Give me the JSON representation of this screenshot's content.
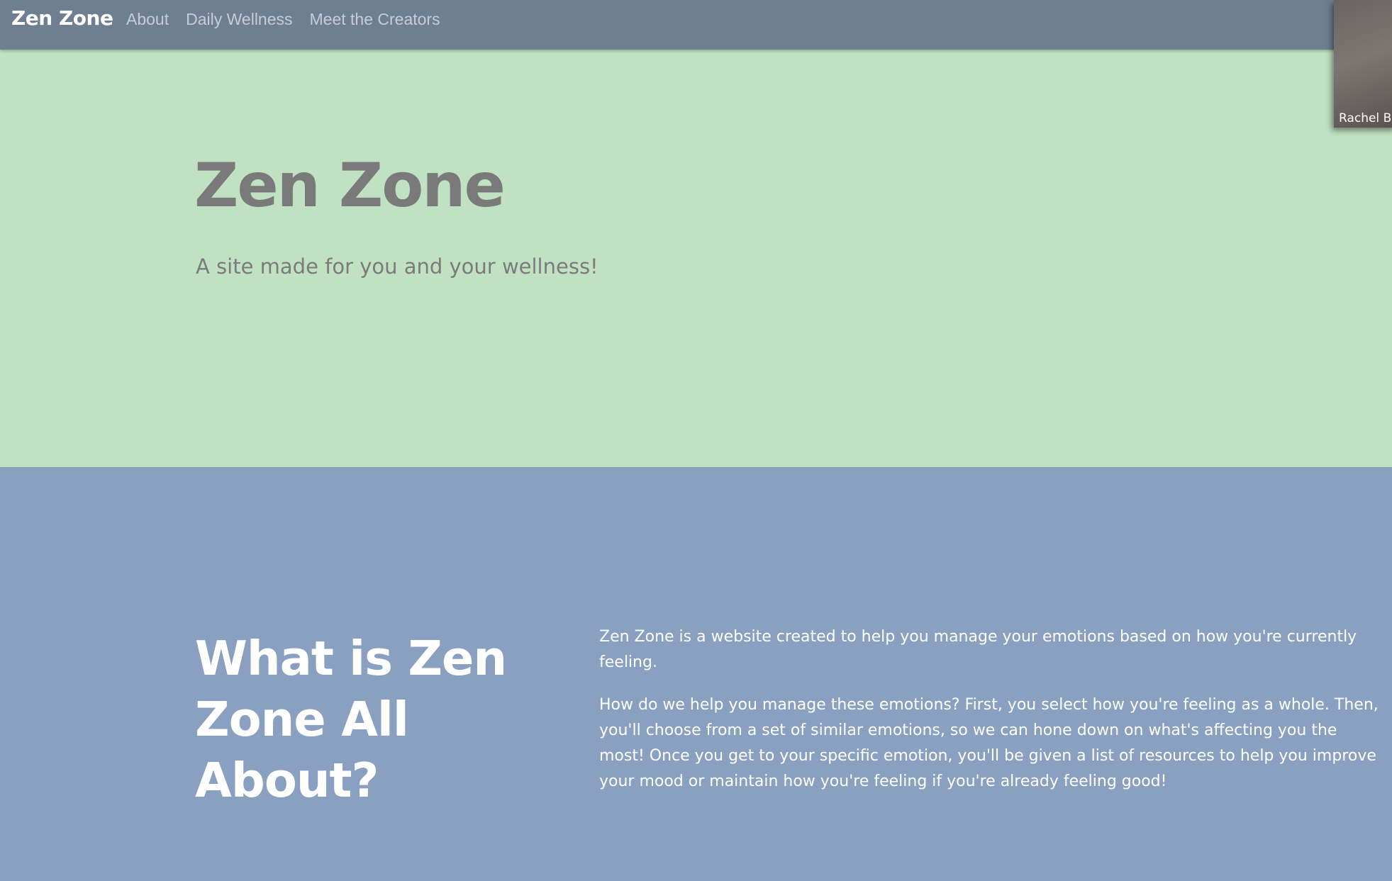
{
  "nav": {
    "brand": "Zen Zone",
    "links": [
      {
        "label": "About"
      },
      {
        "label": "Daily Wellness"
      },
      {
        "label": "Meet the Creators"
      }
    ]
  },
  "hero": {
    "title": "Zen Zone",
    "subtitle": "A site made for you and your wellness!"
  },
  "about": {
    "heading": "What is Zen Zone All About?",
    "paragraphs": [
      "Zen Zone is a website created to help you manage your emotions based on how you're currently feeling.",
      "How do we help you manage these emotions? First, you select how you're feeling as a whole. Then, you'll choose from a set of similar emotions, so we can hone down on what's affecting you the most! Once you get to your specific emotion, you'll be given a list of resources to help you improve your mood or maintain how you're feeling if you're already feeling good!"
    ]
  },
  "video_overlay": {
    "participant_name": "Rachel B"
  },
  "colors": {
    "navbar": "#6f7f92",
    "hero_background": "#c0e2c2",
    "about_background": "#8aa0c0",
    "hero_text": "#7a7a7a",
    "nav_link": "#c7ccd4"
  }
}
